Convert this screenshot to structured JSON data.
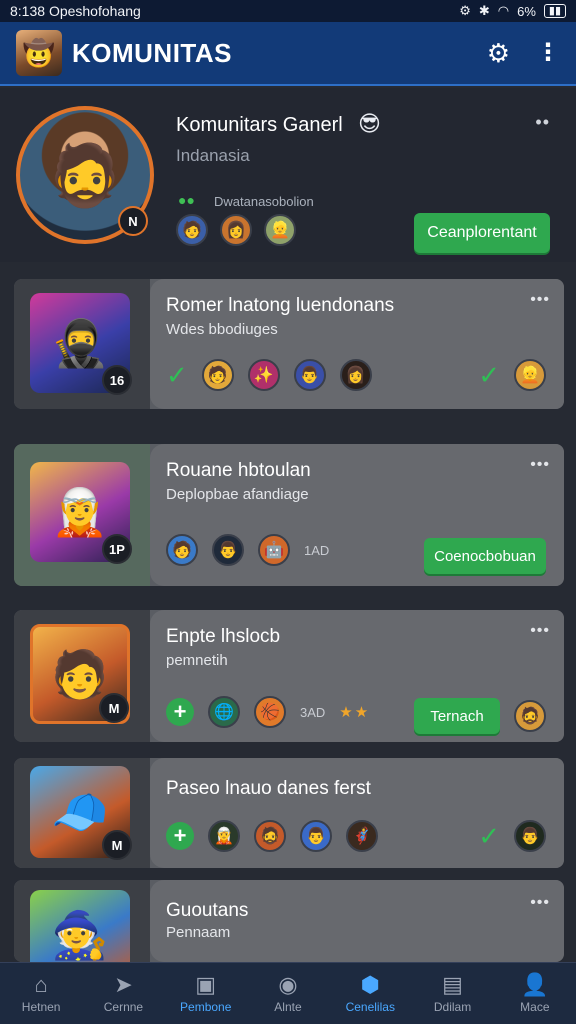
{
  "status_bar": {
    "time": "8:138",
    "carrier": "Opeshofohang",
    "battery": "6%"
  },
  "app_bar": {
    "title": "KOMUNITAS"
  },
  "header": {
    "title": "Komunitars Ganerl",
    "subtitle": "Indanasia",
    "members_label": "Dwatanasobolion",
    "badge": "N",
    "button_label": "Ceanplorentant"
  },
  "cards": [
    {
      "title": "Romer lnatong luendonans",
      "subtitle": "Wdes bbodiuges",
      "badge": "16",
      "row_text": "",
      "button_label": ""
    },
    {
      "title": "Rouane hbtoulan",
      "subtitle": "Deplopbae afandiage",
      "badge": "1P",
      "row_text": "1AD",
      "button_label": "Coenocbobuan"
    },
    {
      "title": "Enpte lhslocb",
      "subtitle": "pemnetih",
      "badge": "M",
      "row_text": "3AD",
      "button_label": "Ternach"
    },
    {
      "title": "Paseo lnauo danes ferst",
      "subtitle": "",
      "badge": "M",
      "row_text": "",
      "button_label": ""
    },
    {
      "title": "Guoutans",
      "subtitle": "Pennaam",
      "badge": "",
      "row_text": "",
      "button_label": ""
    }
  ],
  "bottom_nav": [
    {
      "label": "Hetnen",
      "icon": "home-icon"
    },
    {
      "label": "Cernne",
      "icon": "arrow-icon"
    },
    {
      "label": "Pembone",
      "icon": "window-icon"
    },
    {
      "label": "Alnte",
      "icon": "circle-icon"
    },
    {
      "label": "Cenelilas",
      "icon": "community-icon"
    },
    {
      "label": "Ddilam",
      "icon": "folder-icon"
    },
    {
      "label": "Mace",
      "icon": "profile-icon"
    }
  ],
  "colors": {
    "accent": "#2fa84f",
    "app_bar": "#123a78",
    "active_nav": "#4aa8ff",
    "avatar_ring": "#e0742a"
  }
}
